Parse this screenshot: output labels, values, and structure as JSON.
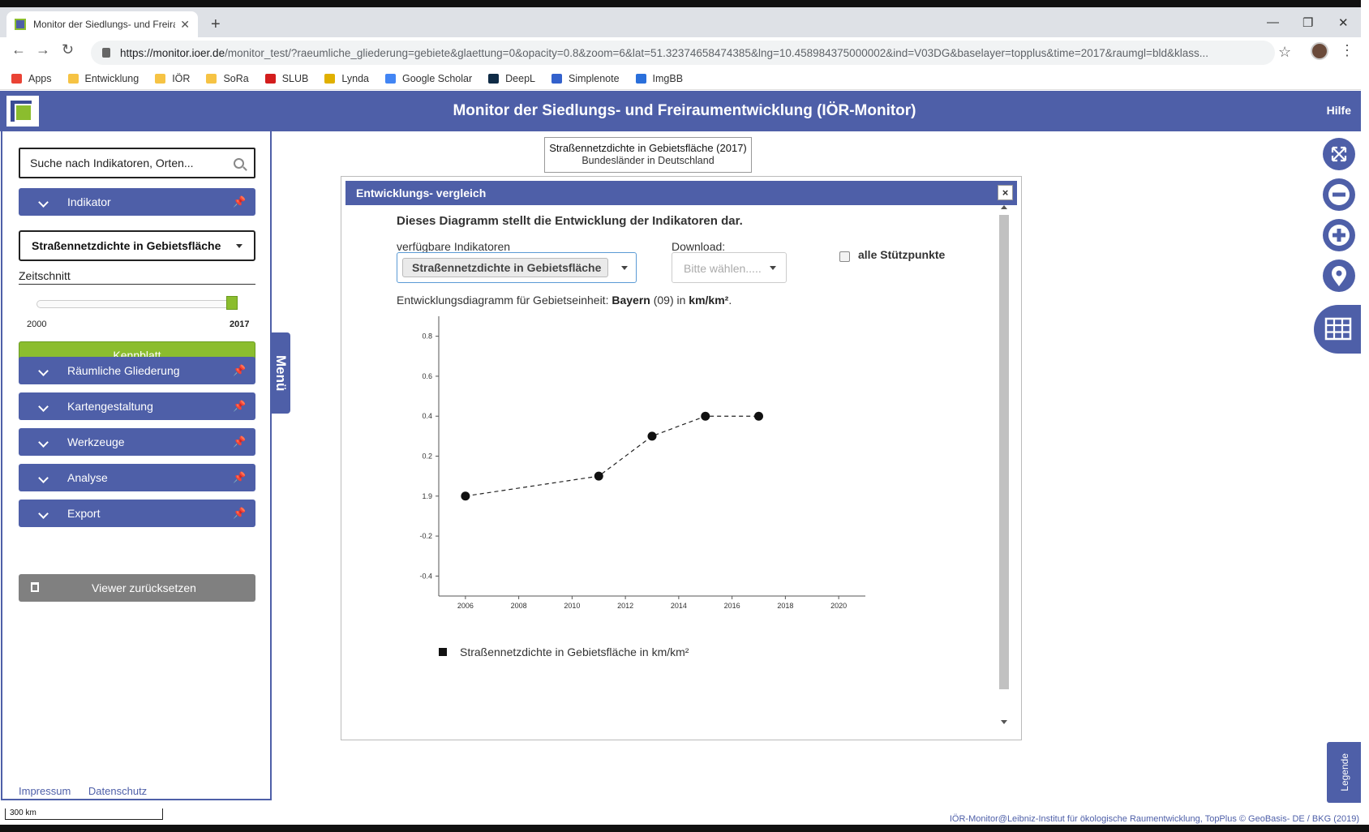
{
  "browser": {
    "tab_title": "Monitor der Siedlungs- und Freira",
    "url_host": "https://monitor.ioer.de",
    "url_path": "/monitor_test/?raeumliche_gliederung=gebiete&glaettung=0&opacity=0.8&zoom=6&lat=51.32374658474385&lng=10.458984375000002&ind=V03DG&baselayer=topplus&time=2017&raumgl=bld&klass...",
    "bookmarks": [
      {
        "label": "Apps",
        "color": "#ea4335"
      },
      {
        "label": "Entwicklung",
        "color": "#f6c344"
      },
      {
        "label": "IÖR",
        "color": "#f6c344"
      },
      {
        "label": "SoRa",
        "color": "#f6c344"
      },
      {
        "label": "SLUB",
        "color": "#d31d1d"
      },
      {
        "label": "Lynda",
        "color": "#e0b000"
      },
      {
        "label": "Google Scholar",
        "color": "#4285f4"
      },
      {
        "label": "DeepL",
        "color": "#0f2b46"
      },
      {
        "label": "Simplenote",
        "color": "#3361cc"
      },
      {
        "label": "ImgBB",
        "color": "#2a6fdb"
      }
    ]
  },
  "header": {
    "title": "Monitor der Siedlungs- und Freiraumentwicklung (IÖR-Monitor)",
    "help": "Hilfe",
    "accent": "#4e5fa8"
  },
  "sidebar": {
    "search_placeholder": "Suche nach Indikatoren, Orten...",
    "indikator": "Indikator",
    "selected_indicator": "Straßennetzdichte in Gebietsfläche",
    "zeitschnitt": "Zeitschnitt",
    "slider_min": "2000",
    "slider_max": "2017",
    "slider_value": 2017,
    "kennblatt": "Kennblatt",
    "sections": [
      "Räumliche Gliederung",
      "Kartengestaltung",
      "Werkzeuge",
      "Analyse",
      "Export"
    ],
    "reset": "Viewer zurücksetzen",
    "impressum": "Impressum",
    "datenschutz": "Datenschutz",
    "menu_tab": "Menü"
  },
  "map_title": {
    "line1": "Straßennetzdichte in Gebietsfläche (2017)",
    "line2": "Bundesländer in Deutschland"
  },
  "dialog": {
    "title": "Entwicklungs- vergleich",
    "close": "×",
    "intro": "Dieses Diagramm stellt die Entwicklung der Indikatoren dar.",
    "available_label": "verfügbare Indikatoren",
    "available_value": "Straßennetzdichte in Gebietsfläche",
    "download_label": "Download:",
    "download_placeholder": "Bitte wählen.....",
    "checkbox_label": "alle Stützpunkte",
    "caption_prefix": "Entwicklungsdiagramm für Gebietseinheit:",
    "caption_region": "Bayern",
    "caption_code": "(09) in",
    "caption_unit": "km/km²",
    "caption_end": "."
  },
  "chart_data": {
    "type": "line",
    "x": [
      2006,
      2011,
      2013,
      2015,
      2017
    ],
    "y": [
      0.0,
      0.1,
      0.3,
      0.4,
      0.4
    ],
    "series": [
      {
        "name": "Straßennetzdichte in Gebietsfläche in km/km²"
      }
    ],
    "xticks": [
      "2006",
      "2008",
      "2010",
      "2012",
      "2014",
      "2016",
      "2018",
      "2020"
    ],
    "yticks": [
      "-0.4",
      "-0.2",
      "1.9",
      "0.2",
      "0.4",
      "0.6",
      "0.8"
    ],
    "xlim": [
      2006,
      2020
    ],
    "ylim": [
      -0.4,
      0.8
    ],
    "line_style": "dashed",
    "grid": false,
    "legend": "bottom-left"
  },
  "scalebar": "300 km",
  "attribution": "IÖR-Monitor@Leibniz-Institut für ökologische Raumentwicklung, TopPlus © GeoBasis- DE / BKG (2019)",
  "legende": "Legende"
}
